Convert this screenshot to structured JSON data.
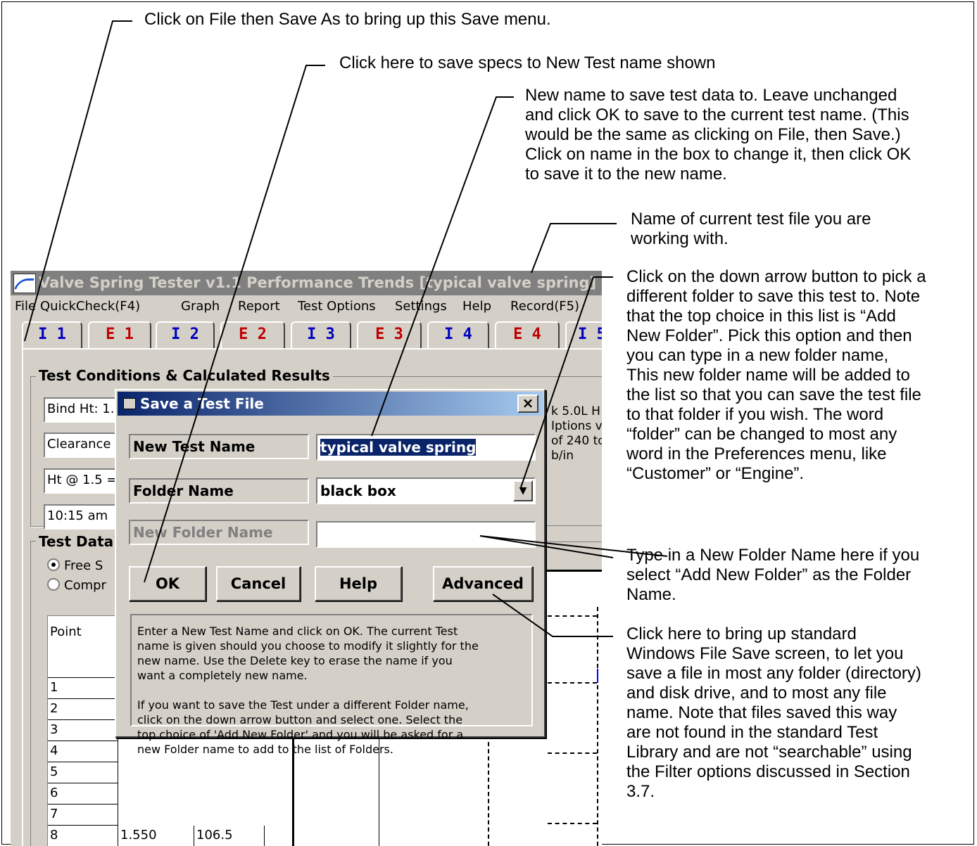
{
  "annotations": {
    "file_save_as": "Click on File then Save As to bring up this Save menu.",
    "ok_button": "Click here to save specs to New Test name shown",
    "new_name": "New name to save test data to.  Leave unchanged\nand click OK to save to the current test name.  (This\nwould be the same as clicking on File, then Save.)\nClick on name in the box to change it, then click OK\nto save it to the new name.",
    "current_file": "Name of current test file you are\nworking with.",
    "folder_dropdown": "Click on the down arrow button to pick a\ndifferent folder to save this test to.  Note\nthat the top choice in this list is “Add\nNew Folder”.  Pick this option and then\nyou can type in a new folder name,\nThis new folder name will be added to\nthe list so that you can save the test file\nto that folder if you wish.  The word\n“folder” can be changed to most any\nword in the Preferences menu, like\n“Customer” or “Engine”.",
    "new_folder_name": "Type in a New Folder Name here if you\nselect “Add New Folder” as the Folder\nName.",
    "advanced": "Click here to bring up standard\nWindows File Save screen, to let you\nsave a file in most any folder (directory)\nand disk drive, and to most any file\nname.  Note that files saved this way\nare not found in the standard Test\nLibrary and are not “searchable” using\nthe Filter options discussed in Section\n3.7."
  },
  "app": {
    "title": "Valve Spring Tester v1.1   Performance Trends   [typical valve spring]",
    "menu": [
      "File",
      "QuickCheck(F4)",
      "Graph",
      "Report",
      "Test Options",
      "Settings",
      "Help",
      "Record(F5)"
    ],
    "tabs": [
      "I 1",
      "E 1",
      "I 2",
      "E 2",
      "I 3",
      "E 3",
      "I 4",
      "E 4",
      "I 5"
    ],
    "group_conditions": "Test Conditions & Calculated Results",
    "fields": [
      "Bind Ht: 1.",
      "Clearance",
      "Ht @ 1.5 =",
      "10:15 am"
    ],
    "right_text": "k 5.0L H\nIptions v\nof 240 to\nb/in",
    "group_data": "Test Data",
    "radio_free": "Free S",
    "radio_compressed": "Compr",
    "grid_header": "Point",
    "rows": [
      "1",
      "2",
      "3",
      "4",
      "5",
      "6",
      "7",
      "8"
    ],
    "row8_values": [
      "1.550",
      "106.5"
    ]
  },
  "dialog": {
    "title": "Save a Test File",
    "close": "×",
    "new_test_name_label": "New Test Name",
    "new_test_name_value": "typical valve spring",
    "folder_name_label": "Folder Name",
    "folder_name_value": "black box",
    "new_folder_name_label": "New Folder Name",
    "new_folder_name_value": "",
    "buttons": {
      "ok": "OK",
      "cancel": "Cancel",
      "help": "Help",
      "advanced": "Advanced"
    },
    "help_text": "Enter a New Test Name and click on OK.  The current Test\nname is given should you choose to modify it slightly for the\nnew name.  Use the Delete key to erase the name if you\nwant a completely new name.\n\nIf you want to save the Test under a different Folder name,\nclick on the down arrow button and select one.  Select the\ntop choice of 'Add New Folder' and you will be asked for a\nnew Folder name to add to the list of Folders."
  }
}
